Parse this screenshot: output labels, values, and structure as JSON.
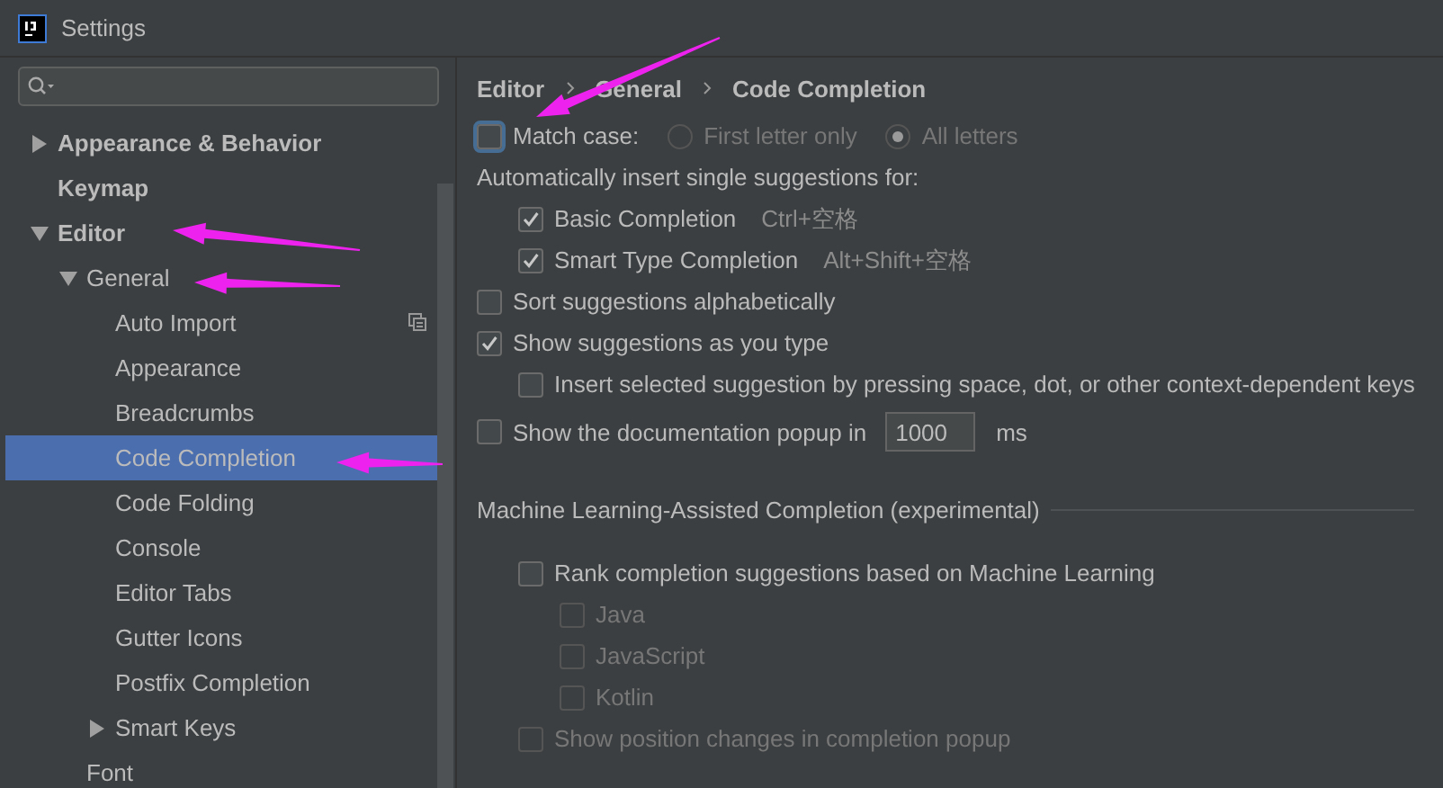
{
  "window": {
    "title": "Settings"
  },
  "sidebar": {
    "items": [
      {
        "label": "Appearance & Behavior",
        "expanded": false,
        "selected": false,
        "scheme_icon": false
      },
      {
        "label": "Keymap",
        "selected": false,
        "scheme_icon": false
      },
      {
        "label": "Editor",
        "expanded": true,
        "selected": false,
        "scheme_icon": false,
        "children": [
          {
            "label": "General",
            "expanded": true,
            "selected": false,
            "scheme_icon": false,
            "children": [
              {
                "label": "Auto Import",
                "selected": false,
                "scheme_icon": true
              },
              {
                "label": "Appearance",
                "selected": false,
                "scheme_icon": false
              },
              {
                "label": "Breadcrumbs",
                "selected": false,
                "scheme_icon": false
              },
              {
                "label": "Code Completion",
                "selected": true,
                "scheme_icon": false
              },
              {
                "label": "Code Folding",
                "selected": false,
                "scheme_icon": false
              },
              {
                "label": "Console",
                "selected": false,
                "scheme_icon": false
              },
              {
                "label": "Editor Tabs",
                "selected": false,
                "scheme_icon": false
              },
              {
                "label": "Gutter Icons",
                "selected": false,
                "scheme_icon": false
              },
              {
                "label": "Postfix Completion",
                "selected": false,
                "scheme_icon": false
              },
              {
                "label": "Smart Keys",
                "expanded": false,
                "selected": false,
                "scheme_icon": false
              }
            ]
          },
          {
            "label": "Font",
            "selected": false,
            "scheme_icon": false
          }
        ]
      }
    ]
  },
  "breadcrumb": [
    "Editor",
    "General",
    "Code Completion"
  ],
  "options": [
    {
      "kind": "checkbox",
      "label": "Match case:",
      "checked": false,
      "focused": true,
      "disabled": false,
      "radios": [
        {
          "label": "First letter only",
          "selected": false,
          "disabled": true
        },
        {
          "label": "All letters",
          "selected": true,
          "disabled": true
        }
      ]
    },
    {
      "kind": "label",
      "label": "Automatically insert single suggestions for:",
      "children": [
        {
          "kind": "checkbox",
          "label": "Basic Completion",
          "shortcut": "Ctrl+空格",
          "checked": true,
          "focused": false,
          "disabled": false
        },
        {
          "kind": "checkbox",
          "label": "Smart Type Completion",
          "shortcut": "Alt+Shift+空格",
          "checked": true,
          "focused": false,
          "disabled": false
        }
      ]
    },
    {
      "kind": "checkbox",
      "label": "Sort suggestions alphabetically",
      "checked": false,
      "focused": false,
      "disabled": false
    },
    {
      "kind": "checkbox",
      "label": "Show suggestions as you type",
      "checked": true,
      "focused": false,
      "disabled": false,
      "children": [
        {
          "kind": "checkbox",
          "label": "Insert selected suggestion by pressing space, dot, or other context-dependent keys",
          "checked": false,
          "focused": false,
          "disabled": false
        }
      ]
    },
    {
      "kind": "checkbox",
      "label": "Show the documentation popup in",
      "checked": false,
      "focused": false,
      "disabled": false,
      "field": {
        "value": "1000"
      },
      "unit": "ms"
    },
    {
      "kind": "section",
      "label": "Machine Learning-Assisted Completion (experimental)",
      "children": [
        {
          "kind": "checkbox",
          "label": "Rank completion suggestions based on Machine Learning",
          "checked": false,
          "focused": false,
          "disabled": false,
          "children": [
            {
              "kind": "checkbox",
              "label": "Java",
              "checked": false,
              "focused": false,
              "disabled": true
            },
            {
              "kind": "checkbox",
              "label": "JavaScript",
              "checked": false,
              "focused": false,
              "disabled": true
            },
            {
              "kind": "checkbox",
              "label": "Kotlin",
              "checked": false,
              "focused": false,
              "disabled": true
            }
          ]
        },
        {
          "kind": "checkbox",
          "label": "Show position changes in completion popup",
          "checked": false,
          "focused": false,
          "disabled": true
        }
      ]
    }
  ]
}
